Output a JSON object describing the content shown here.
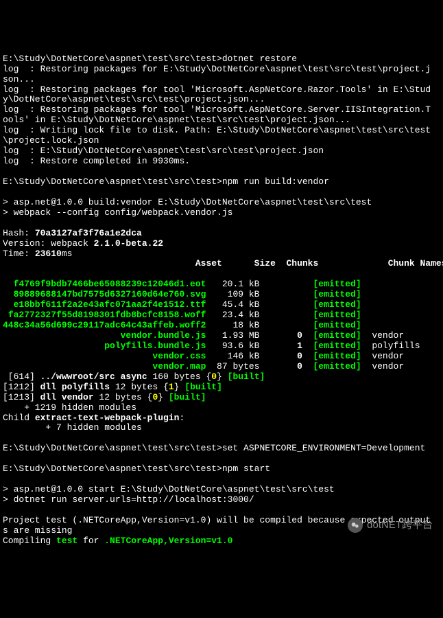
{
  "lines": [
    {
      "segments": [
        {
          "c": "white",
          "t": ""
        }
      ]
    },
    {
      "segments": [
        {
          "c": "white",
          "t": "E:\\Study\\DotNetCore\\aspnet\\test\\src\\test>dotnet restore"
        }
      ]
    },
    {
      "segments": [
        {
          "c": "white",
          "t": "log  : Restoring packages for E:\\Study\\DotNetCore\\aspnet\\test\\src\\test\\project.j"
        }
      ]
    },
    {
      "segments": [
        {
          "c": "white",
          "t": "son..."
        }
      ]
    },
    {
      "segments": [
        {
          "c": "white",
          "t": "log  : Restoring packages for tool 'Microsoft.AspNetCore.Razor.Tools' in E:\\Stud"
        }
      ]
    },
    {
      "segments": [
        {
          "c": "white",
          "t": "y\\DotNetCore\\aspnet\\test\\src\\test\\project.json..."
        }
      ]
    },
    {
      "segments": [
        {
          "c": "white",
          "t": "log  : Restoring packages for tool 'Microsoft.AspNetCore.Server.IISIntegration.T"
        }
      ]
    },
    {
      "segments": [
        {
          "c": "white",
          "t": "ools' in E:\\Study\\DotNetCore\\aspnet\\test\\src\\test\\project.json..."
        }
      ]
    },
    {
      "segments": [
        {
          "c": "white",
          "t": "log  : Writing lock file to disk. Path: E:\\Study\\DotNetCore\\aspnet\\test\\src\\test"
        }
      ]
    },
    {
      "segments": [
        {
          "c": "white",
          "t": "\\project.lock.json"
        }
      ]
    },
    {
      "segments": [
        {
          "c": "white",
          "t": "log  : E:\\Study\\DotNetCore\\aspnet\\test\\src\\test\\project.json"
        }
      ]
    },
    {
      "segments": [
        {
          "c": "white",
          "t": "log  : Restore completed in 9930ms."
        }
      ]
    },
    {
      "segments": [
        {
          "c": "white",
          "t": ""
        }
      ]
    },
    {
      "segments": [
        {
          "c": "white",
          "t": "E:\\Study\\DotNetCore\\aspnet\\test\\src\\test>npm run build:vendor"
        }
      ]
    },
    {
      "segments": [
        {
          "c": "white",
          "t": ""
        }
      ]
    },
    {
      "segments": [
        {
          "c": "white",
          "t": "> asp.net@1.0.0 build:vendor E:\\Study\\DotNetCore\\aspnet\\test\\src\\test"
        }
      ]
    },
    {
      "segments": [
        {
          "c": "white",
          "t": "> webpack --config config/webpack.vendor.js"
        }
      ]
    },
    {
      "segments": [
        {
          "c": "white",
          "t": ""
        }
      ]
    },
    {
      "segments": [
        {
          "c": "white",
          "t": "Hash: "
        },
        {
          "c": "white-bold",
          "t": "70a3127af3f76a1e2dca"
        }
      ]
    },
    {
      "segments": [
        {
          "c": "white",
          "t": "Version: webpack "
        },
        {
          "c": "white-bold",
          "t": "2.1.0-beta.22"
        }
      ]
    },
    {
      "segments": [
        {
          "c": "white",
          "t": "Time: "
        },
        {
          "c": "white-bold",
          "t": "23610"
        },
        {
          "c": "white",
          "t": "ms"
        }
      ]
    },
    {
      "segments": [
        {
          "c": "white-bold",
          "t": "                                    Asset      Size  Chunks             Chunk Names"
        }
      ]
    },
    {
      "segments": [
        {
          "c": "white",
          "t": ""
        }
      ]
    },
    {
      "segments": [
        {
          "c": "green",
          "t": "  f4769f9bdb7466be65088239c12046d1.eot"
        },
        {
          "c": "white",
          "t": "   20.1 kB          "
        },
        {
          "c": "green",
          "t": "[emitted]"
        }
      ]
    },
    {
      "segments": [
        {
          "c": "green",
          "t": "  89889688147bd7575d6327160d64e760.svg"
        },
        {
          "c": "white",
          "t": "    109 kB          "
        },
        {
          "c": "green",
          "t": "[emitted]"
        }
      ]
    },
    {
      "segments": [
        {
          "c": "green",
          "t": "  e18bbf611f2a2e43afc071aa2f4e1512.ttf"
        },
        {
          "c": "white",
          "t": "   45.4 kB          "
        },
        {
          "c": "green",
          "t": "[emitted]"
        }
      ]
    },
    {
      "segments": [
        {
          "c": "green",
          "t": " fa2772327f55d8198301fdb8bcfc8158.woff"
        },
        {
          "c": "white",
          "t": "   23.4 kB          "
        },
        {
          "c": "green",
          "t": "[emitted]"
        }
      ]
    },
    {
      "segments": [
        {
          "c": "green",
          "t": "448c34a56d699c29117adc64c43affeb.woff2"
        },
        {
          "c": "white",
          "t": "     18 kB          "
        },
        {
          "c": "green",
          "t": "[emitted]"
        }
      ]
    },
    {
      "segments": [
        {
          "c": "green",
          "t": "                      vendor.bundle.js"
        },
        {
          "c": "white",
          "t": "   1.93 MB       "
        },
        {
          "c": "white-bold",
          "t": "0"
        },
        {
          "c": "white",
          "t": "  "
        },
        {
          "c": "green",
          "t": "[emitted]"
        },
        {
          "c": "white",
          "t": "  vendor"
        }
      ]
    },
    {
      "segments": [
        {
          "c": "green",
          "t": "                   polyfills.bundle.js"
        },
        {
          "c": "white",
          "t": "   93.6 kB       "
        },
        {
          "c": "white-bold",
          "t": "1"
        },
        {
          "c": "white",
          "t": "  "
        },
        {
          "c": "green",
          "t": "[emitted]"
        },
        {
          "c": "white",
          "t": "  polyfills"
        }
      ]
    },
    {
      "segments": [
        {
          "c": "green",
          "t": "                            vendor.css"
        },
        {
          "c": "white",
          "t": "    146 kB       "
        },
        {
          "c": "white-bold",
          "t": "0"
        },
        {
          "c": "white",
          "t": "  "
        },
        {
          "c": "green",
          "t": "[emitted]"
        },
        {
          "c": "white",
          "t": "  vendor"
        }
      ]
    },
    {
      "segments": [
        {
          "c": "green",
          "t": "                            vendor.map"
        },
        {
          "c": "white",
          "t": "  87 bytes       "
        },
        {
          "c": "white-bold",
          "t": "0"
        },
        {
          "c": "white",
          "t": "  "
        },
        {
          "c": "green",
          "t": "[emitted]"
        },
        {
          "c": "white",
          "t": "  vendor"
        }
      ]
    },
    {
      "segments": [
        {
          "c": "white",
          "t": " [614] "
        },
        {
          "c": "white-bold",
          "t": "../wwwroot/src async"
        },
        {
          "c": "white",
          "t": " 160 bytes {"
        },
        {
          "c": "yellow",
          "t": "0"
        },
        {
          "c": "white",
          "t": "} "
        },
        {
          "c": "green",
          "t": "[built]"
        }
      ]
    },
    {
      "segments": [
        {
          "c": "white",
          "t": "[1212] "
        },
        {
          "c": "white-bold",
          "t": "dll polyfills"
        },
        {
          "c": "white",
          "t": " 12 bytes {"
        },
        {
          "c": "yellow",
          "t": "1"
        },
        {
          "c": "white",
          "t": "} "
        },
        {
          "c": "green",
          "t": "[built]"
        }
      ]
    },
    {
      "segments": [
        {
          "c": "white",
          "t": "[1213] "
        },
        {
          "c": "white-bold",
          "t": "dll vendor"
        },
        {
          "c": "white",
          "t": " 12 bytes {"
        },
        {
          "c": "yellow",
          "t": "0"
        },
        {
          "c": "white",
          "t": "} "
        },
        {
          "c": "green",
          "t": "[built]"
        }
      ]
    },
    {
      "segments": [
        {
          "c": "white",
          "t": "    + 1219 hidden modules"
        }
      ]
    },
    {
      "segments": [
        {
          "c": "white",
          "t": "Child "
        },
        {
          "c": "white-bold",
          "t": "extract-text-webpack-plugin"
        },
        {
          "c": "white",
          "t": ":"
        }
      ]
    },
    {
      "segments": [
        {
          "c": "white",
          "t": "        + 7 hidden modules"
        }
      ]
    },
    {
      "segments": [
        {
          "c": "white",
          "t": ""
        }
      ]
    },
    {
      "segments": [
        {
          "c": "white",
          "t": "E:\\Study\\DotNetCore\\aspnet\\test\\src\\test>set ASPNETCORE_ENVIRONMENT=Development"
        }
      ]
    },
    {
      "segments": [
        {
          "c": "white",
          "t": ""
        }
      ]
    },
    {
      "segments": [
        {
          "c": "white",
          "t": "E:\\Study\\DotNetCore\\aspnet\\test\\src\\test>npm start"
        }
      ]
    },
    {
      "segments": [
        {
          "c": "white",
          "t": ""
        }
      ]
    },
    {
      "segments": [
        {
          "c": "white",
          "t": "> asp.net@1.0.0 start E:\\Study\\DotNetCore\\aspnet\\test\\src\\test"
        }
      ]
    },
    {
      "segments": [
        {
          "c": "white",
          "t": "> dotnet run server.urls=http://localhost:3000/"
        }
      ]
    },
    {
      "segments": [
        {
          "c": "white",
          "t": ""
        }
      ]
    },
    {
      "segments": [
        {
          "c": "white",
          "t": "Project test (.NETCoreApp,Version=v1.0) will be compiled because expected output"
        }
      ]
    },
    {
      "segments": [
        {
          "c": "white",
          "t": "s are missing"
        }
      ]
    },
    {
      "segments": [
        {
          "c": "white",
          "t": "Compiling "
        },
        {
          "c": "green",
          "t": "test"
        },
        {
          "c": "white",
          "t": " for "
        },
        {
          "c": "green",
          "t": ".NETCoreApp,Version=v1.0"
        }
      ]
    }
  ],
  "watermark": "dotNET跨平台"
}
